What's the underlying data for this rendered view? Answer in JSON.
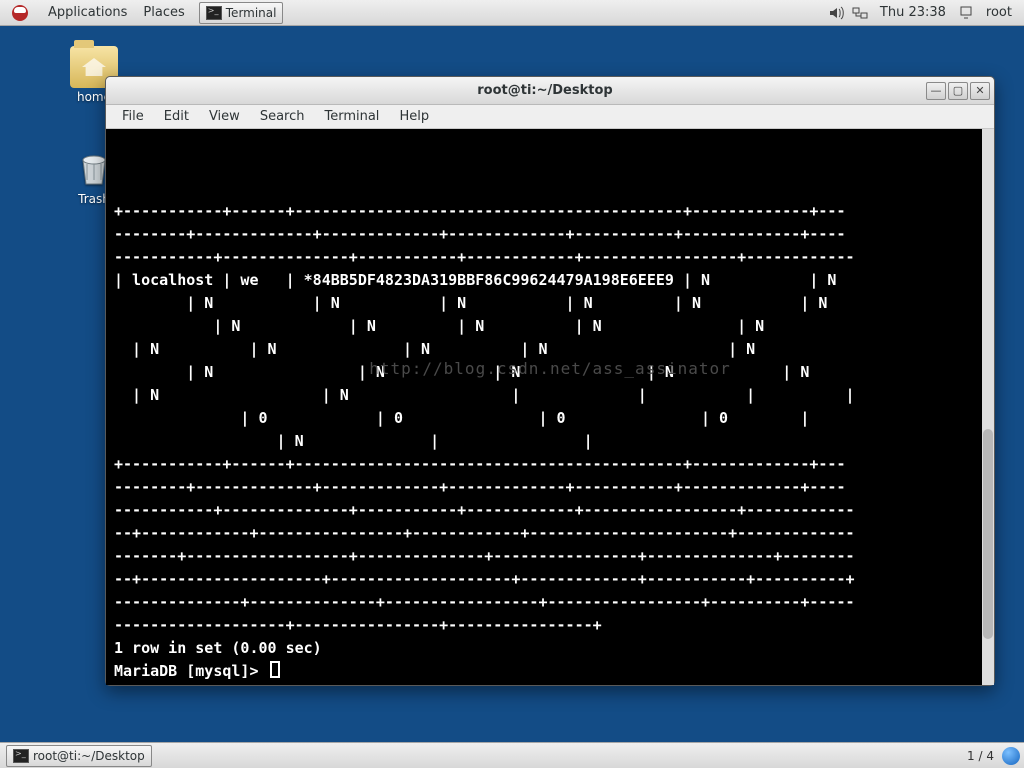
{
  "panel": {
    "applications": "Applications",
    "places": "Places",
    "task_terminal": "Terminal",
    "clock": "Thu 23:38",
    "user": "root"
  },
  "desktop": {
    "home_label": "home",
    "trash_label": "Trash"
  },
  "window": {
    "title": "root@ti:~/Desktop",
    "menus": {
      "file": "File",
      "edit": "Edit",
      "view": "View",
      "search": "Search",
      "terminal": "Terminal",
      "help": "Help"
    }
  },
  "terminal": {
    "lines": [
      "+-----------+------+-------------------------------------------+-------------+---",
      "--------+-------------+-------------+-------------+-----------+-------------+----",
      "-----------+--------------+-----------+------------+-----------------+------------",
      "| localhost | we   | *84BB5DF4823DA319BBF86C99624479A198E6EEE9 | N           | N ",
      "        | N           | N           | N           | N         | N           | N  ",
      "           | N            | N         | N          | N               | N         ",
      "  | N          | N              | N          | N                    | N          ",
      "        | N                | N            | N              | N            | N    ",
      "  | N                  | N                  |             |           |          |",
      "              | 0            | 0               | 0               | 0        |    ",
      "                  | N              |                |",
      "+-----------+------+-------------------------------------------+-------------+---",
      "--------+-------------+-------------+-------------+-----------+-------------+----",
      "-----------+--------------+-----------+------------+-----------------+------------",
      "--+------------+----------------+------------+----------------------+-------------",
      "-------+------------------+--------------+----------------+--------------+--------",
      "--+--------------------+--------------------+-------------+-----------+----------+",
      "--------------+--------------+-----------------+-----------------+----------+-----",
      "-------------------+----------------+----------------+",
      "1 row in set (0.00 sec)",
      "",
      "MariaDB [mysql]> "
    ],
    "watermark": "http://blog.csdn.net/ass_assinator"
  },
  "bottom": {
    "task_label": "root@ti:~/Desktop",
    "workspace": "1 / 4"
  }
}
